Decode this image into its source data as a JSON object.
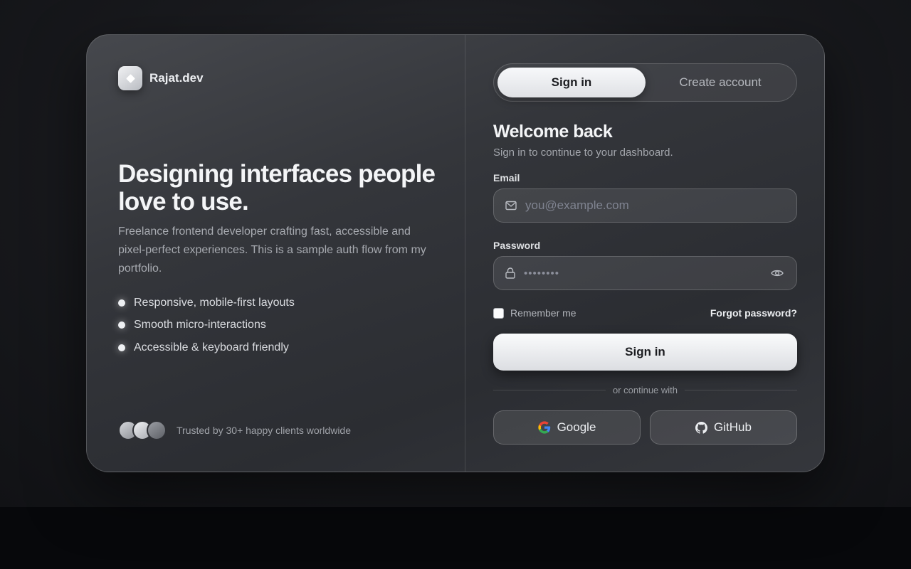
{
  "brand": {
    "name": "Rajat.dev",
    "logo_icon": "diamond-icon"
  },
  "hero": {
    "headline": "Designing interfaces people love to use.",
    "description": "Freelance frontend developer crafting fast, accessible and pixel-perfect experiences. This is a sample auth flow from my portfolio.",
    "features": [
      "Responsive, mobile-first layouts",
      "Smooth micro-interactions",
      "Accessible & keyboard friendly"
    ]
  },
  "trust": {
    "text": "Trusted by 30+ happy clients worldwide"
  },
  "tabs": {
    "sign_in": "Sign in",
    "create_account": "Create account",
    "active": "sign_in"
  },
  "form": {
    "title": "Welcome back",
    "subtitle": "Sign in to continue to your dashboard.",
    "email": {
      "label": "Email",
      "placeholder": "you@example.com",
      "value": ""
    },
    "password": {
      "label": "Password",
      "masked_value": "••••••••"
    },
    "remember_label": "Remember me",
    "remember_checked": false,
    "forgot_label": "Forgot password?",
    "submit_label": "Sign in",
    "divider_text": "or continue with",
    "social": {
      "google_label": "Google",
      "github_label": "GitHub"
    }
  },
  "colors": {
    "accent": "#f4f5f7",
    "background": "#111215",
    "card": "#34363b"
  }
}
